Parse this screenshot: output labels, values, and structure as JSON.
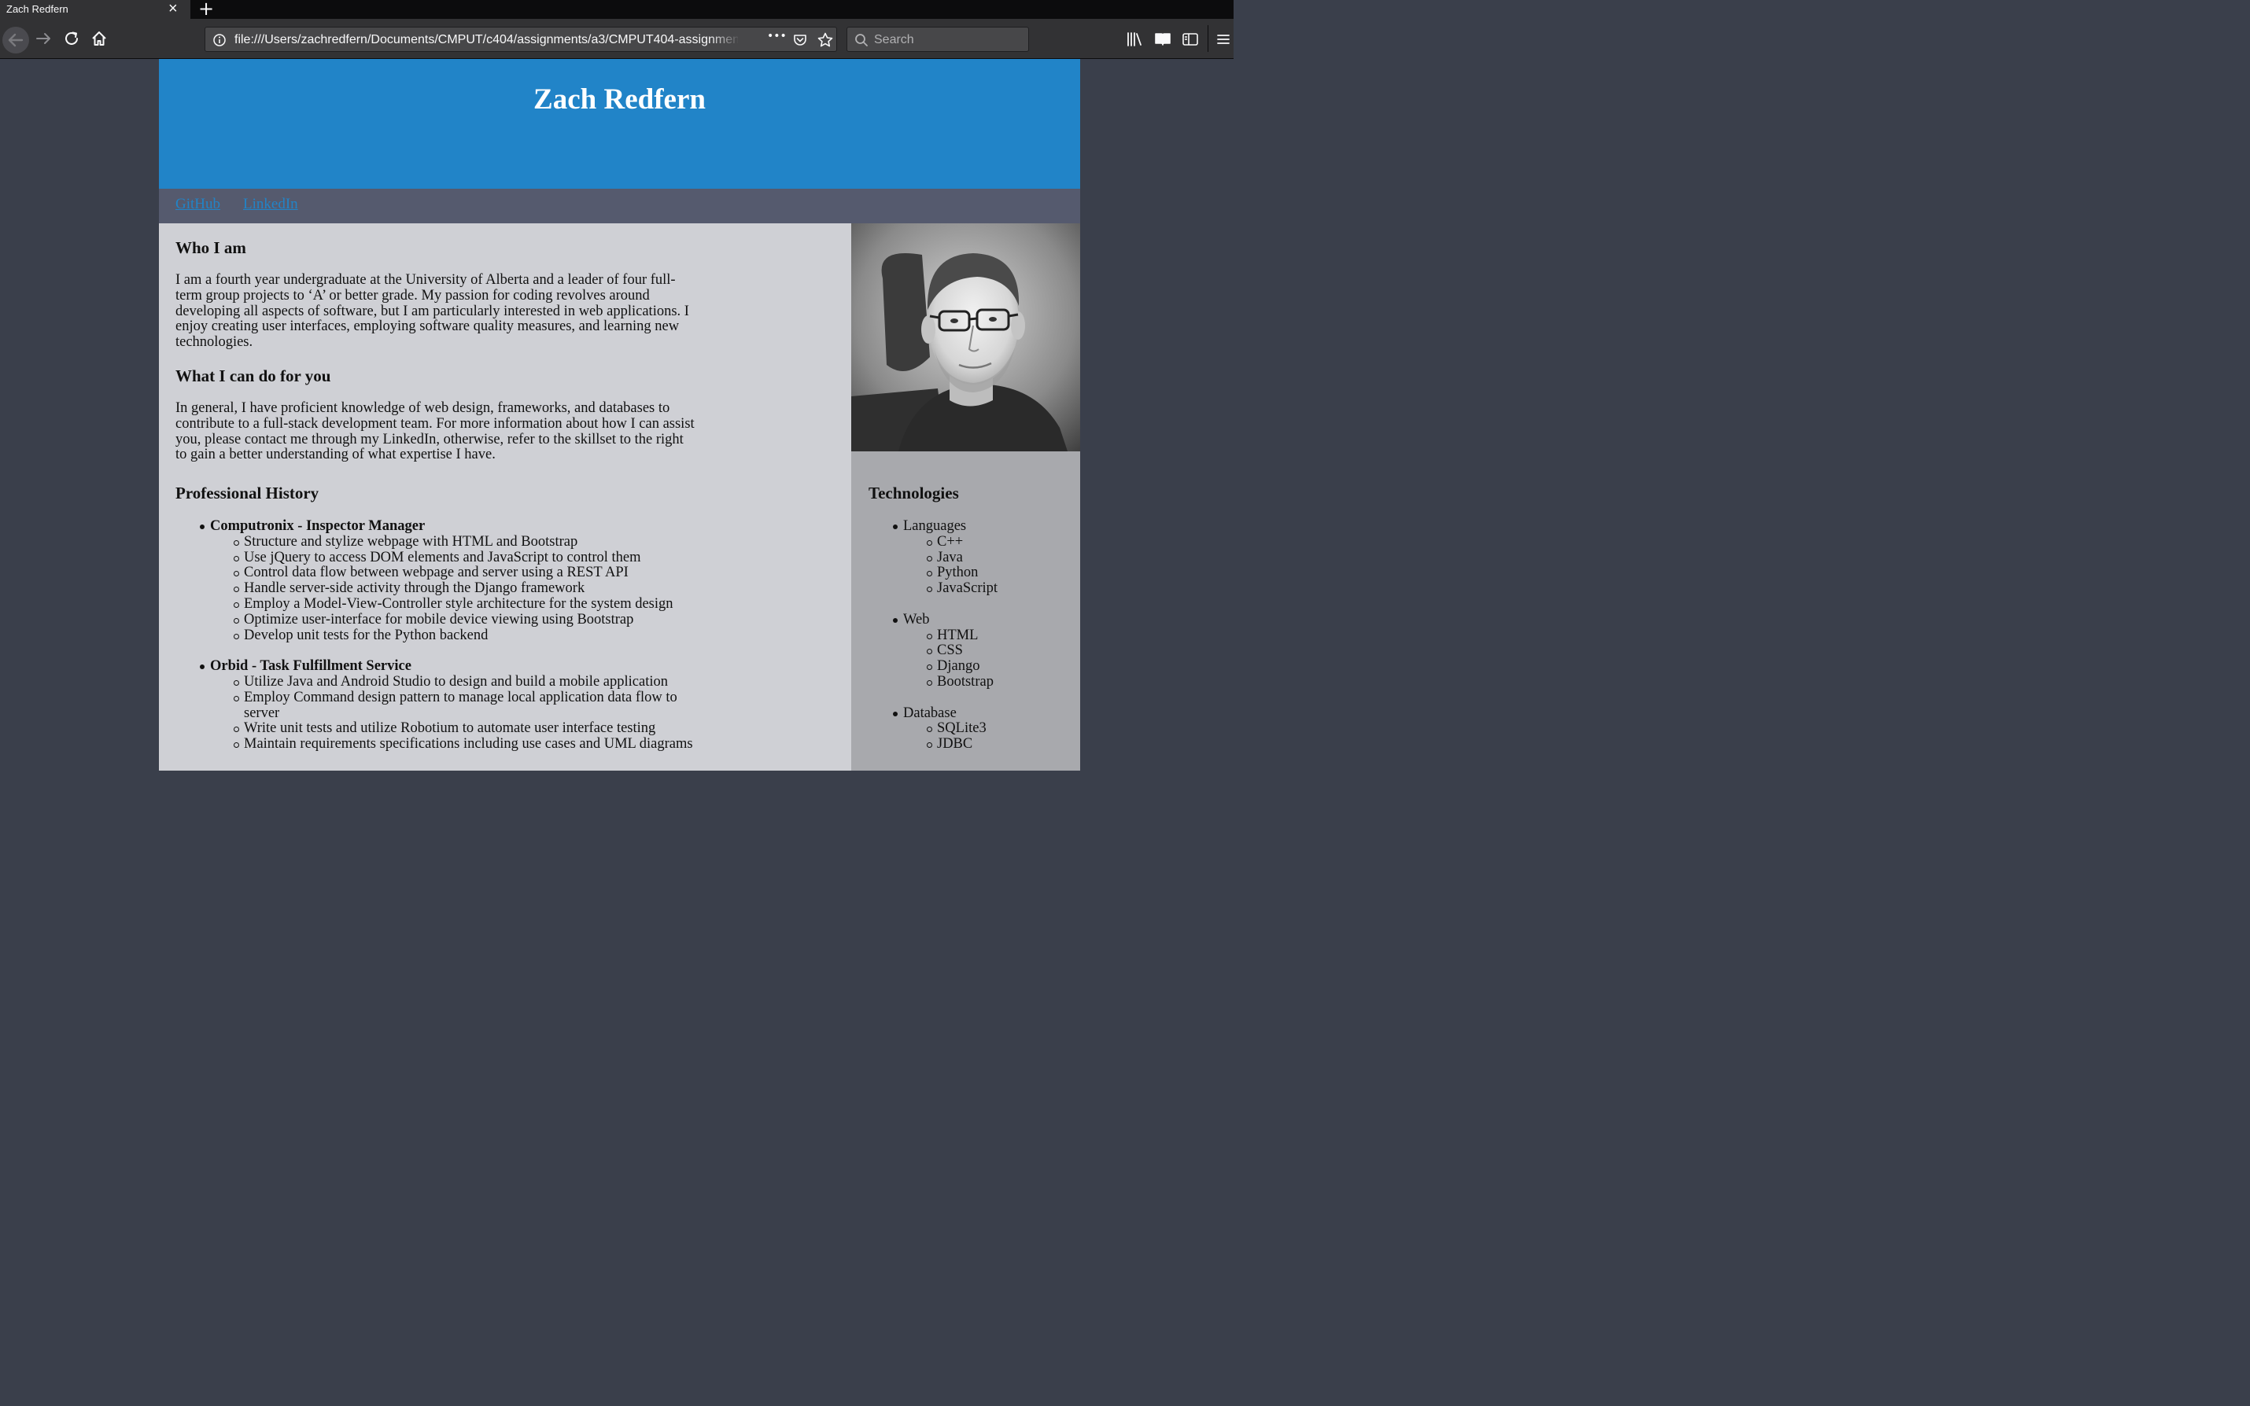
{
  "browser": {
    "tab_title": "Zach Redfern",
    "tab_close": "×",
    "new_tab": "+",
    "url": "file:///Users/zachredfern/Documents/CMPUT/c404/assignments/a3/CMPUT404-assignment",
    "search_placeholder": "Search",
    "more_label": "•••"
  },
  "page": {
    "name": "Zach Redfern",
    "links": [
      {
        "label": "GitHub"
      },
      {
        "label": "LinkedIn"
      }
    ],
    "who_heading": "Who I am",
    "who_text": "I am a fourth year undergraduate at the University of Alberta and a leader of four full-term group projects to ‘A’ or better grade. My passion for coding revolves around developing all aspects of software, but I am particularly interested in web applications. I enjoy creating user interfaces, employing software quality measures, and learning new technologies.",
    "what_heading": "What I can do for you",
    "what_text": "In general, I have proficient knowledge of web design, frameworks, and databases to contribute to a full-stack development team. For more information about how I can assist you, please contact me through my LinkedIn, otherwise, refer to the skillset to the right to gain a better understanding of what expertise I have.",
    "history_heading": "Professional History",
    "jobs": [
      {
        "title": "Computronix - Inspector Manager",
        "items": [
          "Structure and stylize webpage with HTML and Bootstrap",
          "Use jQuery to access DOM elements and JavaScript to control them",
          "Control data flow between webpage and server using a REST API",
          "Handle server-side activity through the Django framework",
          "Employ a Model-View-Controller style architecture for the system design",
          "Optimize user-interface for mobile device viewing using Bootstrap",
          "Develop unit tests for the Python backend"
        ]
      },
      {
        "title": "Orbid - Task Fulfillment Service",
        "items": [
          "Utilize Java and Android Studio to design and build a mobile application",
          "Employ Command design pattern to manage local application data flow to server",
          "Write unit tests and utilize Robotium to automate user interface testing",
          "Maintain requirements specifications including use cases and UML diagrams"
        ]
      }
    ],
    "tech_heading": "Technologies",
    "tech": [
      {
        "category": "Languages",
        "items": [
          "C++",
          "Java",
          "Python",
          "JavaScript"
        ]
      },
      {
        "category": "Web",
        "items": [
          "HTML",
          "CSS",
          "Django",
          "Bootstrap"
        ]
      },
      {
        "category": "Database",
        "items": [
          "SQLite3",
          "JDBC"
        ]
      }
    ]
  },
  "colors": {
    "header": "#2184c8",
    "linkbar": "#555a6e",
    "main_bg": "#cfd0d5",
    "sidebar_bg": "#a8a9ad",
    "link": "#2184c8"
  }
}
